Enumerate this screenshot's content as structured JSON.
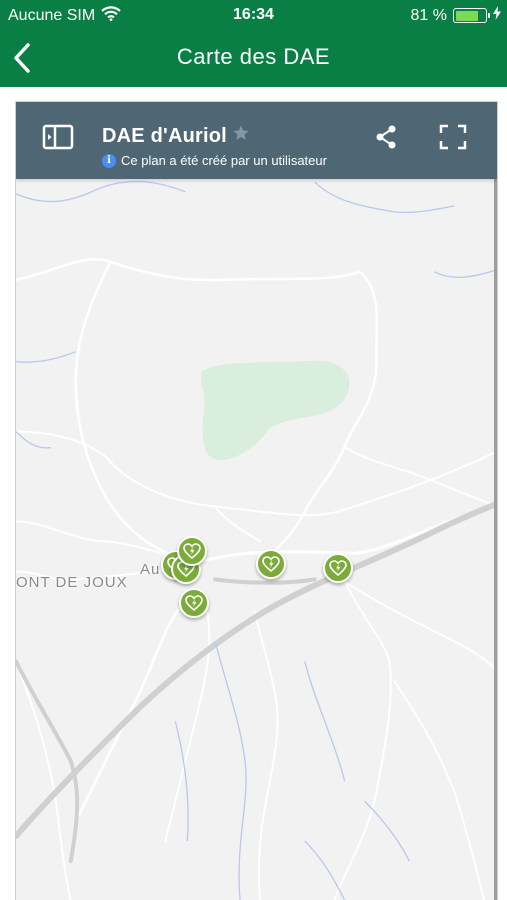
{
  "status_bar": {
    "carrier": "Aucune SIM",
    "time": "16:34",
    "battery": "81 %",
    "battery_level": 0.81
  },
  "nav": {
    "title": "Carte des DAE"
  },
  "map": {
    "title": "DAE d'Auriol",
    "subtitle": "Ce plan a été créé par un utilisateur",
    "labels": {
      "town": "Au",
      "place": "ONT DE JOUX"
    },
    "marker_count": 6
  },
  "colors": {
    "brand_green": "#0a7f45",
    "map_header": "#4f6775",
    "marker": "#7cab3a"
  }
}
